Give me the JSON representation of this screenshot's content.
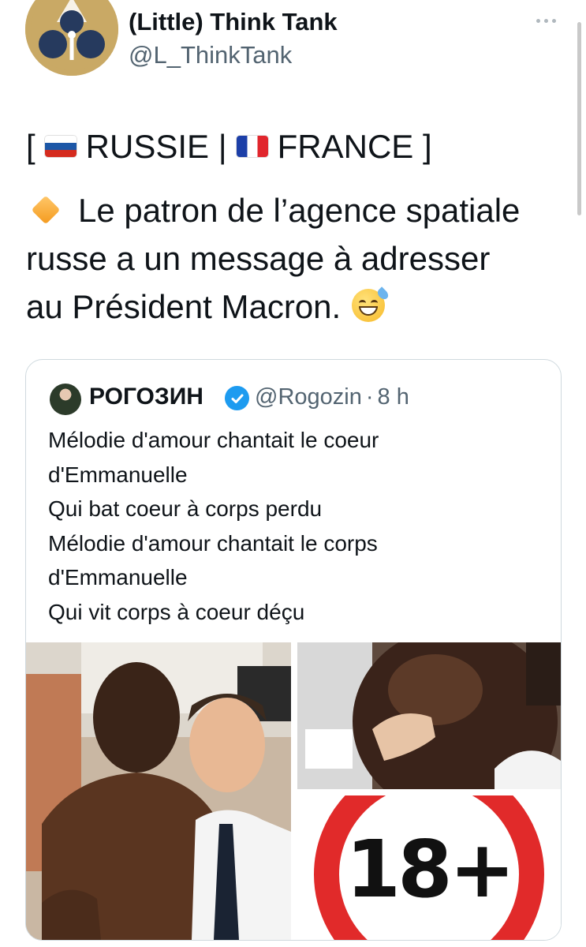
{
  "author": {
    "display_name": "(Little) Think Tank",
    "handle": "@L_ThinkTank",
    "avatar_icon": "think-tank-logo"
  },
  "tweet": {
    "open_bracket": "[",
    "country_one": "RUSSIE",
    "separator": "|",
    "country_two": "FRANCE",
    "close_bracket": "]",
    "line_1": "Le patron de l’agence spatiale",
    "line_2": "russe a un message à adresser",
    "line_3": "au Président Macron.",
    "flag_one_icon": "russia-flag",
    "flag_two_icon": "france-flag",
    "bullet_icon": "orange-diamond",
    "emoji_icon": "grinning-sweat-face"
  },
  "quoted_tweet": {
    "display_name": "РОГОЗИН",
    "verified": true,
    "handle": "@Rogozin",
    "dot": "·",
    "time": "8 h",
    "lines": [
      "Mélodie d'amour chantait le coeur",
      "d'Emmanuelle",
      "Qui bat coeur à corps perdu",
      "Mélodie d'amour chantait le corps",
      "d'Emmanuelle",
      "Qui vit corps à coeur déçu"
    ],
    "media_badge_text": "18+"
  },
  "colors": {
    "text": "#0f1419",
    "secondary": "#536471",
    "verified": "#1d9bf0",
    "border": "#cfd9de",
    "badge_red": "#e12a2a"
  }
}
